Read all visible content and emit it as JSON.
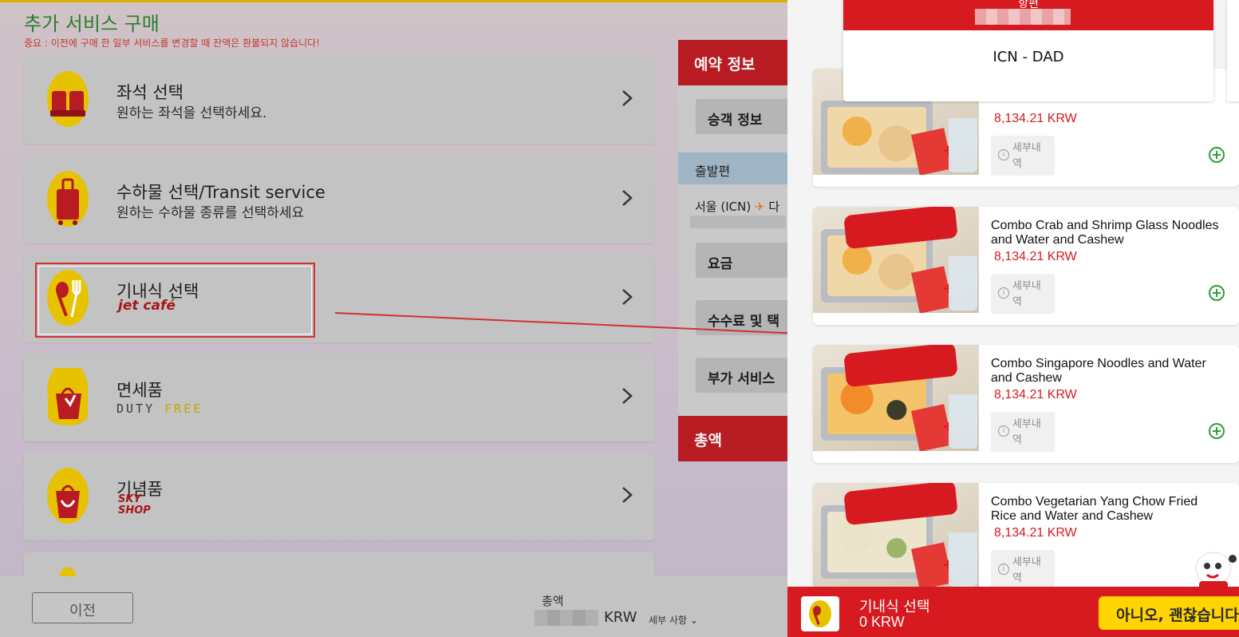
{
  "page": {
    "title": "추가 서비스 구매",
    "notice": "중요 : 이전에 구매 한 일부 서비스를 변경할 때 잔액은 환불되지 않습니다!"
  },
  "services": [
    {
      "title": "좌석 선택",
      "desc": "원하는 좌석을 선택하세요.",
      "icon": "seat-icon"
    },
    {
      "title": "수하물 선택/Transit service",
      "desc": "원하는 수하물 종류를 선택하세요",
      "icon": "luggage-icon"
    },
    {
      "title": "기내식 선택",
      "brand": "jet café",
      "icon": "meal-icon"
    },
    {
      "title": "면세품",
      "brand_a": "DUTY",
      "brand_b": "FREE",
      "icon": "duty-free-bag-icon"
    },
    {
      "title": "기념품",
      "brand": "SKY SHOP",
      "icon": "souvenir-bag-icon"
    }
  ],
  "booking": {
    "header": "예약 정보",
    "passenger": "승객 정보",
    "departure": "출발편",
    "route_from": "서울 (ICN)",
    "route_to": "다",
    "fare": "요금",
    "fees": "수수료 및 택",
    "addons": "부가 서비스",
    "total": "총액"
  },
  "bottom": {
    "prev": "이전",
    "total_label": "총액",
    "currency": "KRW",
    "details": "세부 사항"
  },
  "meal_panel": {
    "flight_label": "항편",
    "route": "ICN - DAD",
    "detail_label": "세부내역",
    "meals": [
      {
        "name": "",
        "price": "8,134.21 KRW"
      },
      {
        "name": "Combo Crab and Shrimp Glass Noodles and Water and Cashew",
        "price": "8,134.21 KRW"
      },
      {
        "name": "Combo Singapore Noodles and Water and Cashew",
        "price": "8,134.21 KRW"
      },
      {
        "name": "Combo Vegetarian Yang Chow Fried Rice and Water and Cashew",
        "price": "8,134.21 KRW"
      }
    ],
    "footer_title": "기내식 선택",
    "footer_total": "0 KRW",
    "decline_button": "아니오, 괜찮습니다"
  },
  "colors": {
    "brand_red": "#d71920",
    "title_green": "#2e7d2e",
    "add_green": "#2e9e3a",
    "accent_yellow": "#ffd400"
  }
}
